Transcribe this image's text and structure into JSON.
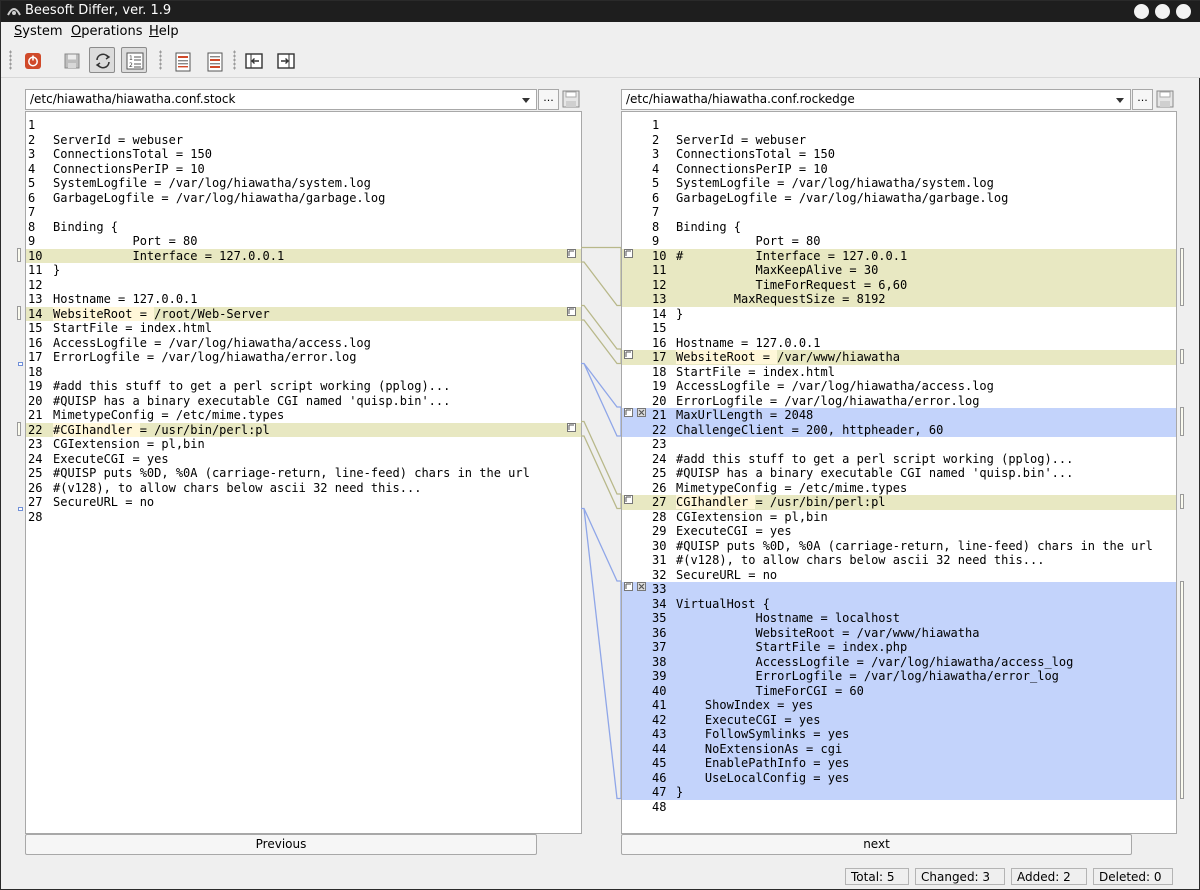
{
  "window": {
    "title": "Beesoft Differ, ver. 1.9"
  },
  "menu": [
    {
      "label": "System",
      "u": "S",
      "rest": "ystem"
    },
    {
      "label": "Operations",
      "u": "O",
      "rest": "perations"
    },
    {
      "label": "Help",
      "u": "H",
      "rest": "elp"
    }
  ],
  "toolbar": [
    {
      "name": "exit-button",
      "icon": "power-icon"
    },
    {
      "name": "save-button",
      "icon": "save-icon"
    },
    {
      "name": "compare-button",
      "icon": "refresh-icon",
      "active": true
    },
    {
      "name": "line-numbers-button",
      "icon": "numbered-list-icon",
      "active": true
    },
    {
      "name": "doc-left-button",
      "icon": "document-icon"
    },
    {
      "name": "doc-right-button",
      "icon": "document-icon"
    },
    {
      "name": "prev-diff-button",
      "icon": "arrow-left-icon"
    },
    {
      "name": "next-diff-button",
      "icon": "arrow-right-icon"
    }
  ],
  "left": {
    "path": "/etc/hiawatha/hiawatha.conf.stock",
    "browse_label": "...",
    "nav_label": "Previous",
    "lines": [
      {
        "n": "1",
        "t": ""
      },
      {
        "n": "2",
        "t": "ServerId = webuser"
      },
      {
        "n": "3",
        "t": "ConnectionsTotal = 150"
      },
      {
        "n": "4",
        "t": "ConnectionsPerIP = 10"
      },
      {
        "n": "5",
        "t": "SystemLogfile = /var/log/hiawatha/system.log"
      },
      {
        "n": "6",
        "t": "GarbageLogfile = /var/log/hiawatha/garbage.log"
      },
      {
        "n": "7",
        "t": ""
      },
      {
        "n": "8",
        "t": "Binding {"
      },
      {
        "n": "9",
        "t": "           Port = 80"
      },
      {
        "n": "10",
        "t": "           Interface = 127.0.0.1",
        "s": "changed"
      },
      {
        "n": "11",
        "t": "}"
      },
      {
        "n": "12",
        "t": ""
      },
      {
        "n": "13",
        "t": "Hostname = 127.0.0.1"
      },
      {
        "n": "14",
        "t": "WebsiteRoot = /root/Web-Server",
        "s": "changed",
        "h": "WebsiteRoot = "
      },
      {
        "n": "15",
        "t": "StartFile = index.html"
      },
      {
        "n": "16",
        "t": "AccessLogfile = /var/log/hiawatha/access.log"
      },
      {
        "n": "17",
        "t": "ErrorLogfile = /var/log/hiawatha/error.log"
      },
      {
        "n": "18",
        "t": ""
      },
      {
        "n": "19",
        "t": "#add this stuff to get a perl script working (pplog)..."
      },
      {
        "n": "20",
        "t": "#QUISP has a binary executable CGI named 'quisp.bin'..."
      },
      {
        "n": "21",
        "t": "MimetypeConfig = /etc/mime.types"
      },
      {
        "n": "22",
        "t": "#CGIhandler = /usr/bin/perl:pl",
        "s": "changed",
        "h": "#CGIhandler "
      },
      {
        "n": "23",
        "t": "CGIextension = pl,bin"
      },
      {
        "n": "24",
        "t": "ExecuteCGI = yes"
      },
      {
        "n": "25",
        "t": "#QUISP puts %0D, %0A (carriage-return, line-feed) chars in the url"
      },
      {
        "n": "26",
        "t": "#(v128), to allow chars below ascii 32 need this..."
      },
      {
        "n": "27",
        "t": "SecureURL = no"
      },
      {
        "n": "28",
        "t": ""
      }
    ]
  },
  "right": {
    "path": "/etc/hiawatha/hiawatha.conf.rockedge",
    "browse_label": "...",
    "nav_label": "next",
    "lines": [
      {
        "n": "1",
        "t": ""
      },
      {
        "n": "2",
        "t": "ServerId = webuser"
      },
      {
        "n": "3",
        "t": "ConnectionsTotal = 150"
      },
      {
        "n": "4",
        "t": "ConnectionsPerIP = 10"
      },
      {
        "n": "5",
        "t": "SystemLogfile = /var/log/hiawatha/system.log"
      },
      {
        "n": "6",
        "t": "GarbageLogfile = /var/log/hiawatha/garbage.log"
      },
      {
        "n": "7",
        "t": ""
      },
      {
        "n": "8",
        "t": "Binding {"
      },
      {
        "n": "9",
        "t": "           Port = 80"
      },
      {
        "n": "10",
        "t": "#          Interface = 127.0.0.1",
        "s": "changed"
      },
      {
        "n": "11",
        "t": "           MaxKeepAlive = 30",
        "s": "changed"
      },
      {
        "n": "12",
        "t": "           TimeForRequest = 6,60",
        "s": "changed"
      },
      {
        "n": "13",
        "t": "        MaxRequestSize = 8192",
        "s": "changed"
      },
      {
        "n": "14",
        "t": "}"
      },
      {
        "n": "15",
        "t": ""
      },
      {
        "n": "16",
        "t": "Hostname = 127.0.0.1"
      },
      {
        "n": "17",
        "t": "WebsiteRoot = /var/www/hiawatha",
        "s": "changed",
        "h": "WebsiteRoot = "
      },
      {
        "n": "18",
        "t": "StartFile = index.html"
      },
      {
        "n": "19",
        "t": "AccessLogfile = /var/log/hiawatha/access.log"
      },
      {
        "n": "20",
        "t": "ErrorLogfile = /var/log/hiawatha/error.log"
      },
      {
        "n": "21",
        "t": "MaxUrlLength = 2048",
        "s": "added"
      },
      {
        "n": "22",
        "t": "ChallengeClient = 200, httpheader, 60",
        "s": "added"
      },
      {
        "n": "23",
        "t": ""
      },
      {
        "n": "24",
        "t": "#add this stuff to get a perl script working (pplog)..."
      },
      {
        "n": "25",
        "t": "#QUISP has a binary executable CGI named 'quisp.bin'..."
      },
      {
        "n": "26",
        "t": "MimetypeConfig = /etc/mime.types"
      },
      {
        "n": "27",
        "t": "CGIhandler = /usr/bin/perl:pl",
        "s": "changed",
        "h": "CGIhandler "
      },
      {
        "n": "28",
        "t": "CGIextension = pl,bin"
      },
      {
        "n": "29",
        "t": "ExecuteCGI = yes"
      },
      {
        "n": "30",
        "t": "#QUISP puts %0D, %0A (carriage-return, line-feed) chars in the url"
      },
      {
        "n": "31",
        "t": "#(v128), to allow chars below ascii 32 need this..."
      },
      {
        "n": "32",
        "t": "SecureURL = no"
      },
      {
        "n": "33",
        "t": "",
        "s": "added"
      },
      {
        "n": "34",
        "t": "VirtualHost {",
        "s": "added"
      },
      {
        "n": "35",
        "t": "           Hostname = localhost",
        "s": "added"
      },
      {
        "n": "36",
        "t": "           WebsiteRoot = /var/www/hiawatha",
        "s": "added"
      },
      {
        "n": "37",
        "t": "           StartFile = index.php",
        "s": "added"
      },
      {
        "n": "38",
        "t": "           AccessLogfile = /var/log/hiawatha/access_log",
        "s": "added"
      },
      {
        "n": "39",
        "t": "           ErrorLogfile = /var/log/hiawatha/error_log",
        "s": "added"
      },
      {
        "n": "40",
        "t": "           TimeForCGI = 60",
        "s": "added"
      },
      {
        "n": "41",
        "t": "    ShowIndex = yes",
        "s": "added"
      },
      {
        "n": "42",
        "t": "    ExecuteCGI = yes",
        "s": "added"
      },
      {
        "n": "43",
        "t": "    FollowSymlinks = yes",
        "s": "added"
      },
      {
        "n": "44",
        "t": "    NoExtensionAs = cgi",
        "s": "added"
      },
      {
        "n": "45",
        "t": "    EnablePathInfo = yes",
        "s": "added"
      },
      {
        "n": "46",
        "t": "    UseLocalConfig = yes",
        "s": "added"
      },
      {
        "n": "47",
        "t": "}",
        "s": "added"
      },
      {
        "n": "48",
        "t": ""
      }
    ]
  },
  "status": {
    "total": "Total: 5",
    "changed": "Changed: 3",
    "added": "Added: 2",
    "deleted": "Deleted: 0"
  },
  "colors": {
    "changed": "#e8e8c2",
    "added": "#c3d3fb",
    "connector_changed": "#b8b88a",
    "connector_added": "#8fa6e8"
  }
}
